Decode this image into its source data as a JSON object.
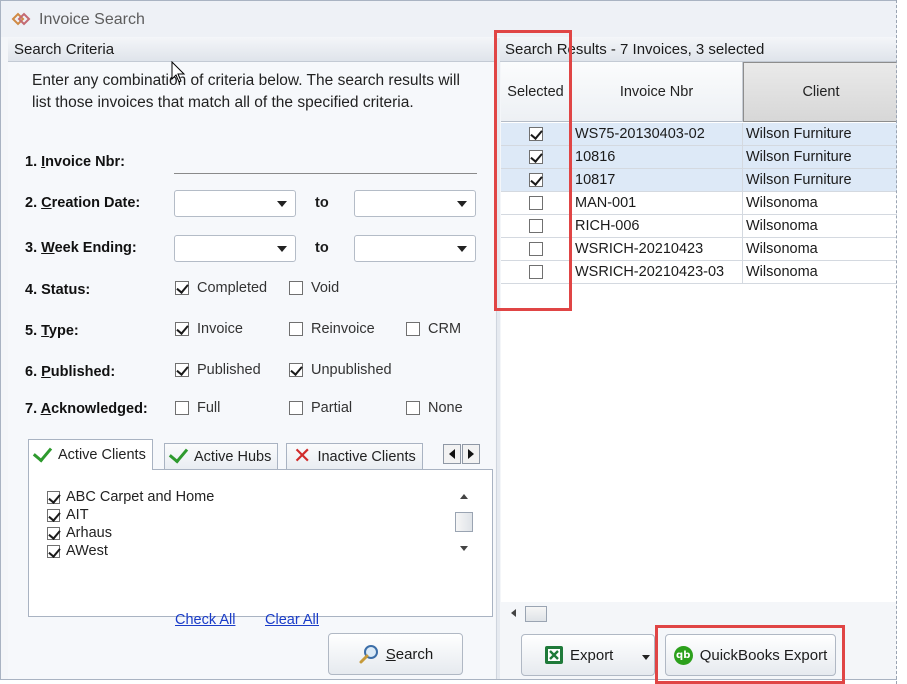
{
  "window": {
    "title": "Invoice Search"
  },
  "criteria": {
    "header": "Search Criteria",
    "intro": "Enter any combination of criteria below.  The search results will list those invoices that match all of the specified criteria.",
    "fields": {
      "invoice_nbr": {
        "prefix": "1. ",
        "key": "I",
        "rest": "nvoice Nbr:",
        "value": ""
      },
      "creation_date": {
        "prefix": "2. ",
        "key": "C",
        "rest": "reation Date:",
        "from": "",
        "to": ""
      },
      "week_ending": {
        "prefix": "3. ",
        "key": "W",
        "rest": "eek Ending:",
        "from": "",
        "to": ""
      },
      "status": {
        "label": "4. Status:",
        "options": [
          {
            "label": "Completed",
            "checked": true
          },
          {
            "label": "Void",
            "checked": false
          }
        ]
      },
      "type": {
        "prefix": "5. ",
        "key": "T",
        "rest": "ype:",
        "options": [
          {
            "label": "Invoice",
            "checked": true
          },
          {
            "label": "Reinvoice",
            "checked": false
          },
          {
            "label": "CRM",
            "checked": false
          }
        ]
      },
      "published": {
        "prefix": "6. ",
        "key": "P",
        "rest": "ublished:",
        "options": [
          {
            "label": "Published",
            "checked": true
          },
          {
            "label": "Unpublished",
            "checked": true
          }
        ]
      },
      "acknowledged": {
        "prefix": "7. ",
        "key": "A",
        "rest": "cknowledged:",
        "options": [
          {
            "label": "Full",
            "checked": false
          },
          {
            "label": "Partial",
            "checked": false
          },
          {
            "label": "None",
            "checked": false
          }
        ]
      }
    },
    "to_label": "to",
    "tabs": [
      {
        "label": "Active Clients",
        "icon": "green-check-icon"
      },
      {
        "label": "Active Hubs",
        "icon": "green-check-icon"
      },
      {
        "label": "Inactive Clients",
        "icon": "red-x-icon"
      }
    ],
    "clients": [
      {
        "name": "ABC Carpet and Home",
        "checked": true
      },
      {
        "name": "AIT",
        "checked": true
      },
      {
        "name": "Arhaus",
        "checked": true
      },
      {
        "name": "AWest",
        "checked": true
      }
    ],
    "check_all": "Check All",
    "clear_all": "Clear All",
    "search_button": {
      "key": "S",
      "rest": "earch"
    }
  },
  "results": {
    "header": "Search Results - 7 Invoices, 3 selected",
    "columns": [
      "Selected",
      "Invoice Nbr",
      "Client"
    ],
    "rows": [
      {
        "selected": true,
        "invoice": "WS75-20130403-02",
        "client": "Wilson Furniture"
      },
      {
        "selected": true,
        "invoice": "10816",
        "client": "Wilson Furniture"
      },
      {
        "selected": true,
        "invoice": "10817",
        "client": "Wilson Furniture"
      },
      {
        "selected": false,
        "invoice": "MAN-001",
        "client": "Wilsonoma"
      },
      {
        "selected": false,
        "invoice": "RICH-006",
        "client": "Wilsonoma"
      },
      {
        "selected": false,
        "invoice": "WSRICH-20210423",
        "client": "Wilsonoma"
      },
      {
        "selected": false,
        "invoice": "WSRICH-20210423-03",
        "client": "Wilsonoma"
      }
    ],
    "export_button": "Export",
    "quickbooks_button": "QuickBooks Export",
    "quickbooks_logo": "qb"
  },
  "colors": {
    "highlight": "#e04545",
    "selected_row": "#dde9f7",
    "link": "#1a3cc8"
  }
}
